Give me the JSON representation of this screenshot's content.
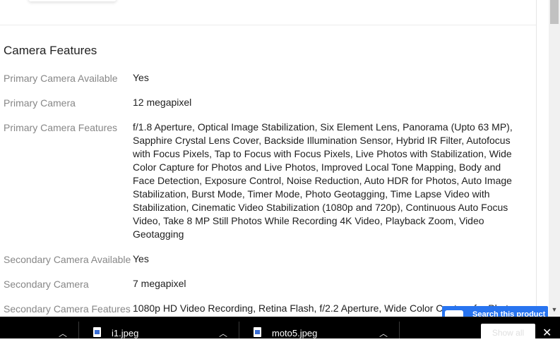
{
  "section": {
    "title": "Camera Features"
  },
  "specs": [
    {
      "label": "Primary Camera Available",
      "value": "Yes"
    },
    {
      "label": "Primary Camera",
      "value": "12 megapixel"
    },
    {
      "label": "Primary Camera Features",
      "value": "f/1.8 Aperture, Optical Image Stabilization, Six Element Lens, Panorama (Upto 63 MP), Sapphire Crystal Lens Cover, Backside Illumination Sensor, Hybrid IR Filter, Autofocus with Focus Pixels, Tap to Focus with Focus Pixels, Live Photos with Stabilization, Wide Color Capture for Photos and Live Photos, Improved Local Tone Mapping, Body and Face Detection, Exposure Control, Noise Reduction, Auto HDR for Photos, Auto Image Stabilization, Burst Mode, Timer Mode, Photo Geotagging, Time Lapse Video with Stabilization, Cinematic Video Stabilization (1080p and 720p), Continuous Auto Focus Video, Take 8 MP Still Photos While Recording 4K Video, Playback Zoom, Video Geotagging"
    },
    {
      "label": "Secondary Camera Available",
      "value": "Yes"
    },
    {
      "label": "Secondary Camera",
      "value": "7 megapixel"
    },
    {
      "label": "Secondary Camera Features",
      "value": "1080p HD Video Recording, Retina Flash, f/2.2 Aperture, Wide Color Capture for Photos"
    }
  ],
  "search_button": {
    "label": "Search this product"
  },
  "downloads": {
    "items": [
      {
        "name": "i1.jpeg"
      },
      {
        "name": "moto5.jpeg"
      }
    ],
    "show_all_label": "Show all",
    "close_icon": "close-icon"
  },
  "colors": {
    "accent": "#2874f0",
    "label_gray": "#878787",
    "download_bar": "#000000"
  }
}
